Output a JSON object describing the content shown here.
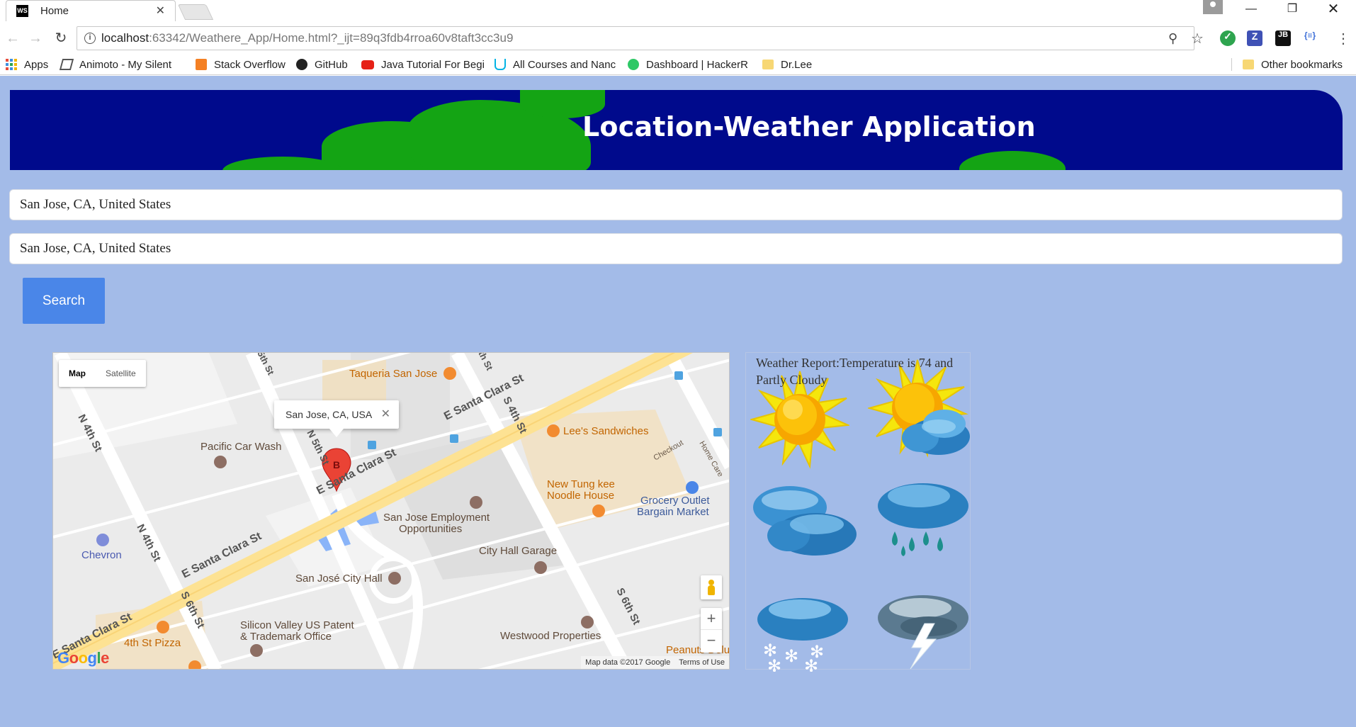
{
  "browser": {
    "tab_title": "Home",
    "tab_favicon": "WS",
    "url_host": "localhost",
    "url_rest": ":63342/Weathere_App/Home.html?_ijt=89q3fdb4rroa60v8taft3cc3u9",
    "bookmarks": [
      {
        "label": "Apps",
        "icon": "apps-grid-icon"
      },
      {
        "label": "Animoto - My Silent",
        "icon": "animoto-icon"
      },
      {
        "label": "Stack Overflow",
        "icon": "stackoverflow-icon"
      },
      {
        "label": "GitHub",
        "icon": "github-icon"
      },
      {
        "label": "Java Tutorial For Begi",
        "icon": "youtube-icon"
      },
      {
        "label": "All Courses and Nanc",
        "icon": "udacity-icon"
      },
      {
        "label": "Dashboard | HackerR",
        "icon": "hackerrank-icon"
      },
      {
        "label": "Dr.Lee",
        "icon": "folder-icon"
      },
      {
        "label": "Other bookmarks",
        "icon": "folder-icon"
      }
    ]
  },
  "header": {
    "title": "Location-Weather Application"
  },
  "form": {
    "origin_value": "San Jose, CA, United States",
    "destination_value": "San Jose, CA, United States",
    "search_label": "Search"
  },
  "map": {
    "type_controls": [
      "Map",
      "Satellite"
    ],
    "info_window": "San Jose, CA, USA",
    "marker_label": "B",
    "street_labels": [
      "N 4th St",
      "N 4th St",
      "N 5th St",
      "E Santa Clara St",
      "E Santa Clara St",
      "E Santa Clara St",
      "E Santa Clara St",
      "S 6th St",
      "S 4th St",
      "S 6th St",
      "5th St",
      "th St"
    ],
    "place_labels": [
      "Taqueria San Jose",
      "Pacific Car Wash",
      "Lee's Sandwiches",
      "New Tung kee",
      "Noodle House",
      "Grocery Outlet",
      "Bargain Market",
      "San Jose Employment",
      "Opportunities",
      "City Hall Garage",
      "Chevron",
      "San José City Hall",
      "Silicon Valley US Patent",
      "& Trademark Office",
      "4th St Pizza",
      "Westwood Properties",
      "Peanuts Delu",
      "Checkout",
      "Home Care"
    ],
    "zoom_in": "+",
    "zoom_out": "−",
    "footer": [
      "Map data ©2017 Google",
      "Terms of Use"
    ],
    "logo": "Google"
  },
  "weather": {
    "report": "Weather Report:Temperature is 74 and Partly Cloudy",
    "icons": [
      "sunny-icon",
      "partly-cloudy-icon",
      "cloudy-icon",
      "rain-icon",
      "snow-icon",
      "thunderstorm-icon"
    ]
  }
}
